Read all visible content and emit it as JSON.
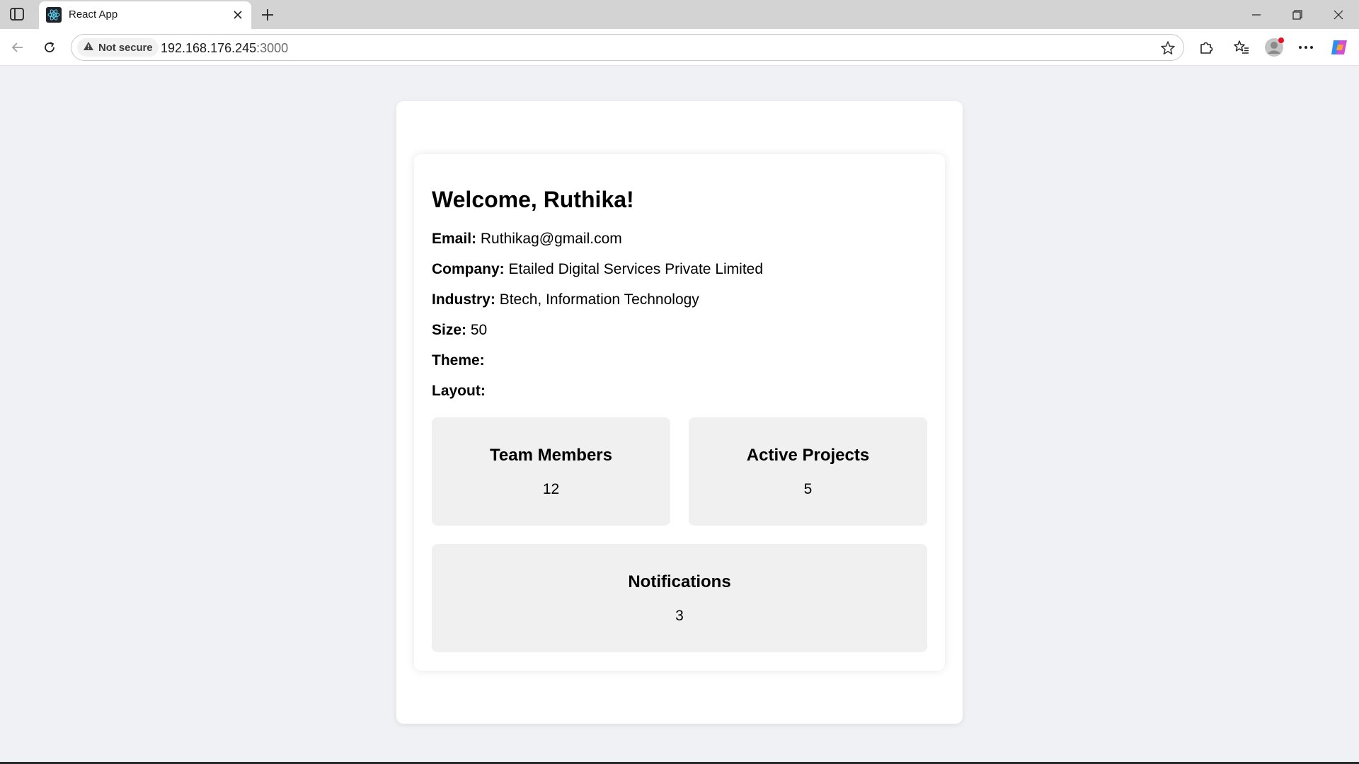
{
  "browser": {
    "tab_title": "React App",
    "address": {
      "security_label": "Not secure",
      "host": "192.168.176.245",
      "port": ":3000"
    }
  },
  "dashboard": {
    "welcome": "Welcome, Ruthika!",
    "fields": [
      {
        "label": "Email:",
        "value": "Ruthikag@gmail.com"
      },
      {
        "label": "Company:",
        "value": "Etailed Digital Services Private Limited"
      },
      {
        "label": "Industry:",
        "value": "Btech, Information Technology"
      },
      {
        "label": "Size:",
        "value": "50"
      },
      {
        "label": "Theme:",
        "value": ""
      },
      {
        "label": "Layout:",
        "value": ""
      }
    ],
    "stats": [
      {
        "title": "Team Members",
        "value": "12"
      },
      {
        "title": "Active Projects",
        "value": "5"
      },
      {
        "title": "Notifications",
        "value": "3"
      }
    ]
  },
  "icons": {
    "sidebar": "sidebar-toggle-icon",
    "favicon": "react-logo-icon",
    "close": "close-icon",
    "new_tab": "plus-icon",
    "back": "arrow-left-icon",
    "reload": "reload-icon",
    "warning": "warning-icon",
    "favorite": "star-icon",
    "extensions": "puzzle-icon",
    "favorites": "favorites-icon",
    "profile": "avatar-icon",
    "more": "more-icon",
    "copilot": "copilot-icon"
  }
}
